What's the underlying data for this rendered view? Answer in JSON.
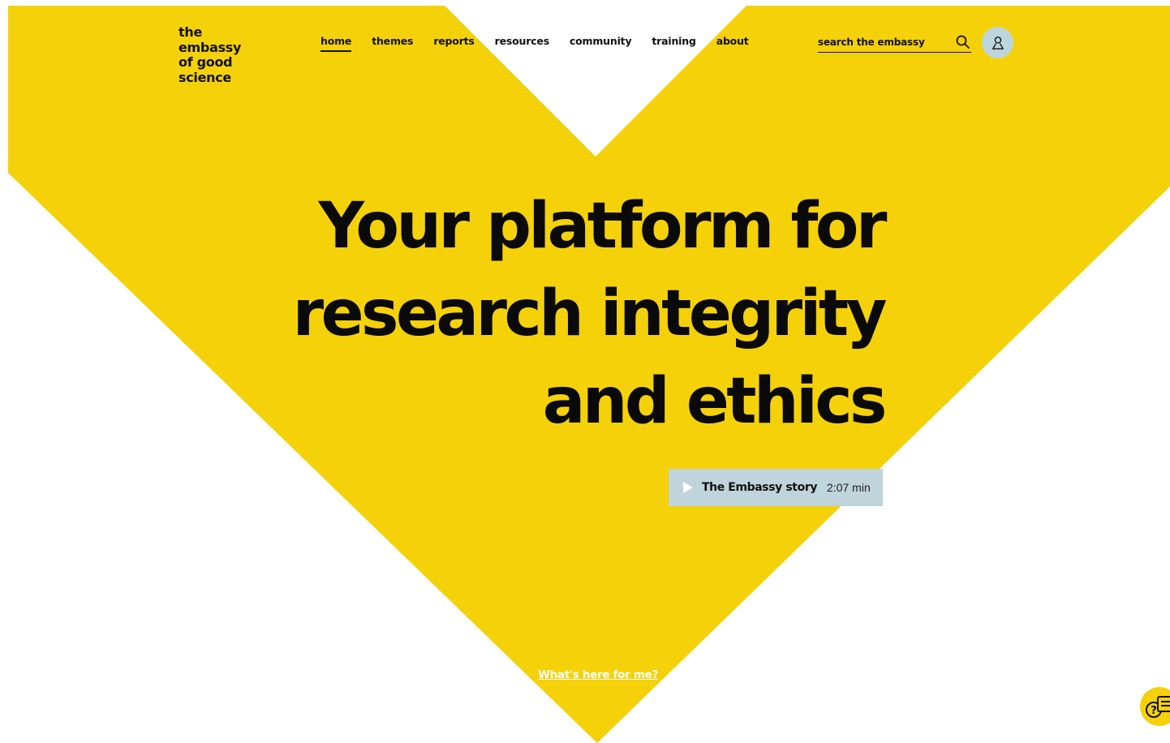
{
  "colors": {
    "brand_yellow": "#f5d10a",
    "accent_blue": "#bfd4db",
    "text_dark": "#111111",
    "background": "#ffffff"
  },
  "header": {
    "logo_lines": [
      "the",
      "embassy",
      "of good",
      "science"
    ],
    "nav": [
      {
        "label": "home",
        "active": true
      },
      {
        "label": "themes",
        "active": false
      },
      {
        "label": "reports",
        "active": false
      },
      {
        "label": "resources",
        "active": false
      },
      {
        "label": "community",
        "active": false
      },
      {
        "label": "training",
        "active": false
      },
      {
        "label": "about",
        "active": false
      }
    ],
    "search": {
      "placeholder": "search the embassy",
      "value": "",
      "icon": "search-icon"
    },
    "account_icon": "user-icon"
  },
  "hero": {
    "title_lines": [
      "Your platform for",
      "research integrity",
      "and ethics"
    ],
    "story_button": {
      "label": "The Embassy story",
      "duration": "2:07 min",
      "icon": "play-icon"
    }
  },
  "footer_link": {
    "label": "What's here for me?"
  },
  "help_button": {
    "icon": "help-chat-icon"
  }
}
